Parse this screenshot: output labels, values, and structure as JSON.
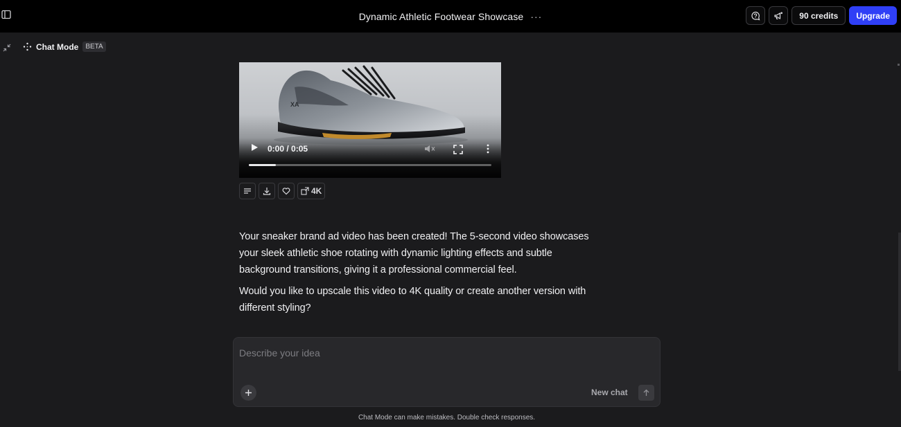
{
  "header": {
    "title": "Dynamic Athletic Footwear Showcase",
    "more_label": "···",
    "credits_label": "90 credits",
    "upgrade_label": "Upgrade",
    "upgrade_color": "#2f3ff6"
  },
  "chat_mode": {
    "label": "Chat Mode",
    "badge": "BETA"
  },
  "video": {
    "time": "0:00 / 0:05",
    "progress": 0.11
  },
  "message_actions": {
    "upscale_label": "4K"
  },
  "message": {
    "paragraph_1": "Your sneaker brand ad video has been created! The 5-second video showcases your sleek athletic shoe rotating with dynamic lighting effects and subtle background transitions, giving it a professional commercial feel.",
    "paragraph_2": "Would you like to upscale this video to 4K quality or create another version with different styling?"
  },
  "composer": {
    "placeholder": "Describe your idea",
    "new_chat_label": "New chat"
  },
  "disclaimer": "Chat Mode can make mistakes. Double check responses."
}
